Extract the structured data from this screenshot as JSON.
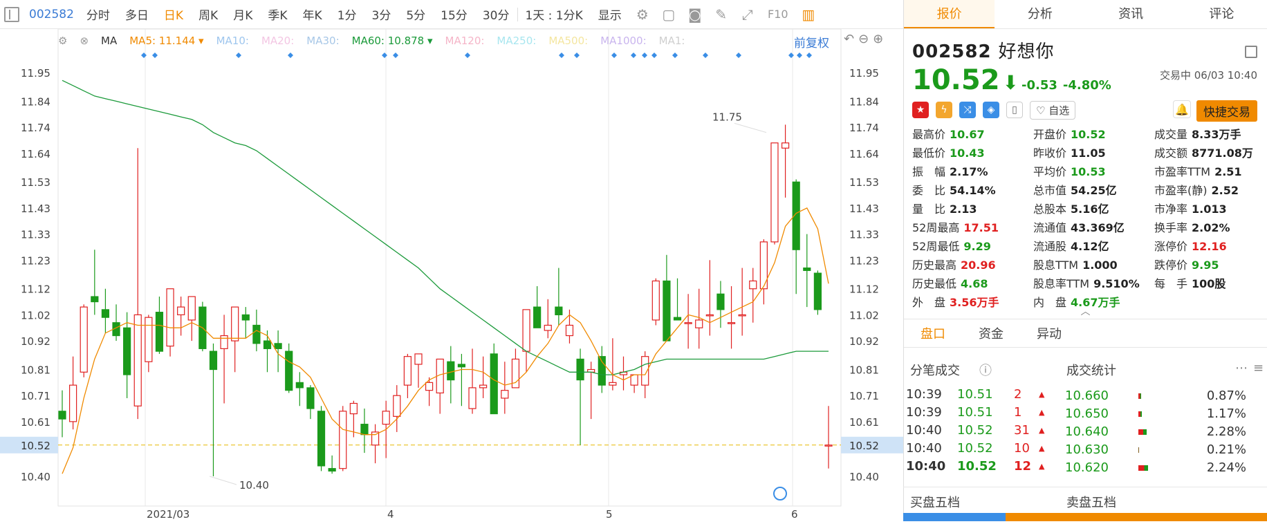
{
  "toolbar": {
    "code": "002582",
    "tabs": [
      "分时",
      "多日",
      "日K",
      "周K",
      "月K",
      "季K",
      "年K",
      "1分",
      "3分",
      "5分",
      "15分",
      "30分"
    ],
    "active_tab": "日K",
    "period_select": "1天 : 1分K",
    "display_label": "显示",
    "f10_label": "F10"
  },
  "ma_bar": {
    "ma_label": "MA",
    "items": [
      {
        "label": "MA5: 11.144",
        "color": "#f08a00",
        "active": true
      },
      {
        "label": "MA10:",
        "color": "#9ec6ee",
        "active": false
      },
      {
        "label": "MA20:",
        "color": "#f3c6e3",
        "active": false
      },
      {
        "label": "MA30:",
        "color": "#a7c7e7",
        "active": false
      },
      {
        "label": "MA60: 10.878",
        "color": "#1b9a3a",
        "active": true
      },
      {
        "label": "MA120:",
        "color": "#f5b5c8",
        "active": false
      },
      {
        "label": "MA250:",
        "color": "#a8e6ef",
        "active": false
      },
      {
        "label": "MA500:",
        "color": "#f4e6a0",
        "active": false
      },
      {
        "label": "MA1000:",
        "color": "#c9b5ee",
        "active": false
      },
      {
        "label": "MA1:",
        "color": "#cfcfcf",
        "active": false
      }
    ],
    "adjust_label": "前复权"
  },
  "chart_data": {
    "type": "candlestick",
    "y_ticks": [
      11.95,
      11.84,
      11.74,
      11.64,
      11.53,
      11.43,
      11.33,
      11.23,
      11.12,
      11.02,
      10.92,
      10.81,
      10.71,
      10.61,
      10.52,
      10.4
    ],
    "x_labels": [
      "2021/03",
      "4",
      "5",
      "6"
    ],
    "current_price_label": "10.52",
    "annotations": {
      "high": "11.75",
      "low": "10.40"
    },
    "up_color": "#e02020",
    "down_color": "#1b9a1b",
    "candles": [
      [
        10.65,
        10.73,
        10.55,
        10.62
      ],
      [
        10.61,
        10.86,
        10.58,
        10.75
      ],
      [
        10.8,
        11.06,
        10.78,
        11.05
      ],
      [
        11.09,
        11.27,
        11.02,
        11.07
      ],
      [
        11.04,
        11.12,
        10.95,
        11.01
      ],
      [
        10.99,
        11.06,
        10.92,
        10.94
      ],
      [
        10.97,
        11.03,
        10.7,
        10.79
      ],
      [
        10.67,
        11.66,
        10.62,
        11.02
      ],
      [
        10.84,
        11.02,
        10.8,
        11.01
      ],
      [
        11.03,
        11.09,
        10.87,
        10.88
      ],
      [
        10.9,
        11.12,
        10.86,
        11.12
      ],
      [
        11.02,
        11.09,
        10.94,
        11.05
      ],
      [
        11.0,
        11.09,
        10.92,
        11.09
      ],
      [
        11.05,
        11.07,
        10.88,
        10.89
      ],
      [
        10.88,
        10.91,
        10.4,
        10.81
      ],
      [
        10.89,
        11.02,
        10.68,
        10.94
      ],
      [
        10.92,
        11.05,
        10.8,
        11.05
      ],
      [
        11.02,
        11.05,
        10.93,
        11.0
      ],
      [
        10.98,
        11.04,
        10.88,
        10.91
      ],
      [
        10.92,
        10.96,
        10.8,
        10.89
      ],
      [
        10.91,
        10.96,
        10.8,
        10.89
      ],
      [
        10.88,
        10.91,
        10.72,
        10.73
      ],
      [
        10.76,
        10.8,
        10.67,
        10.74
      ],
      [
        10.74,
        10.75,
        10.62,
        10.66
      ],
      [
        10.65,
        10.67,
        10.42,
        10.44
      ],
      [
        10.43,
        10.48,
        10.41,
        10.42
      ],
      [
        10.43,
        10.67,
        10.42,
        10.65
      ],
      [
        10.64,
        10.69,
        10.55,
        10.68
      ],
      [
        10.6,
        10.66,
        10.49,
        10.56
      ],
      [
        10.52,
        10.6,
        10.45,
        10.57
      ],
      [
        10.6,
        10.69,
        10.47,
        10.65
      ],
      [
        10.63,
        10.75,
        10.57,
        10.71
      ],
      [
        10.75,
        10.87,
        10.7,
        10.86
      ],
      [
        10.83,
        10.87,
        10.74,
        10.87
      ],
      [
        10.73,
        10.78,
        10.67,
        10.76
      ],
      [
        10.72,
        10.85,
        10.64,
        10.85
      ],
      [
        10.84,
        10.9,
        10.68,
        10.77
      ],
      [
        10.83,
        10.87,
        10.67,
        10.82
      ],
      [
        10.66,
        10.89,
        10.64,
        10.74
      ],
      [
        10.74,
        10.86,
        10.7,
        10.75
      ],
      [
        10.87,
        10.91,
        10.66,
        10.64
      ],
      [
        10.7,
        10.84,
        10.64,
        10.73
      ],
      [
        10.74,
        10.89,
        10.74,
        10.85
      ],
      [
        10.88,
        11.04,
        10.8,
        11.04
      ],
      [
        11.05,
        11.13,
        10.97,
        10.97
      ],
      [
        10.96,
        11.08,
        10.93,
        10.98
      ],
      [
        11.05,
        11.2,
        10.98,
        11.02
      ],
      [
        10.94,
        11.04,
        10.91,
        10.98
      ],
      [
        10.85,
        10.89,
        10.52,
        10.77
      ],
      [
        10.8,
        10.84,
        10.62,
        10.81
      ],
      [
        10.86,
        10.9,
        10.72,
        10.75
      ],
      [
        10.75,
        10.93,
        10.73,
        10.76
      ],
      [
        10.79,
        10.86,
        10.73,
        10.8
      ],
      [
        10.75,
        10.79,
        10.72,
        10.79
      ],
      [
        10.75,
        10.88,
        10.7,
        10.86
      ],
      [
        11.0,
        11.16,
        10.98,
        11.15
      ],
      [
        11.15,
        11.25,
        10.98,
        10.92
      ],
      [
        11.01,
        11.16,
        11.0,
        11.0
      ],
      [
        10.99,
        11.1,
        10.89,
        10.99
      ],
      [
        10.97,
        11.12,
        10.89,
        11.0
      ],
      [
        11.02,
        11.23,
        10.94,
        11.02
      ],
      [
        11.1,
        11.15,
        10.97,
        11.04
      ],
      [
        10.99,
        11.13,
        10.89,
        10.99
      ],
      [
        11.02,
        11.2,
        10.94,
        11.02
      ],
      [
        11.12,
        11.2,
        10.99,
        11.15
      ],
      [
        11.12,
        11.31,
        11.06,
        11.3
      ],
      [
        11.3,
        11.68,
        11.29,
        11.68
      ],
      [
        11.66,
        11.75,
        11.47,
        11.68
      ],
      [
        11.53,
        11.54,
        11.1,
        11.27
      ],
      [
        11.2,
        11.33,
        11.05,
        11.19
      ],
      [
        11.18,
        11.19,
        11.02,
        11.04
      ],
      [
        10.52,
        10.67,
        10.43,
        10.52
      ]
    ],
    "ma5": [
      10.41,
      10.51,
      10.7,
      10.85,
      10.95,
      10.97,
      10.99,
      10.98,
      10.98,
      10.98,
      10.97,
      10.97,
      10.99,
      10.97,
      10.93,
      10.93,
      10.93,
      10.93,
      10.96,
      10.94,
      10.87,
      10.84,
      10.82,
      10.78,
      10.7,
      10.62,
      10.58,
      10.57,
      10.56,
      10.56,
      10.58,
      10.62,
      10.67,
      10.73,
      10.77,
      10.79,
      10.8,
      10.81,
      10.81,
      10.8,
      10.77,
      10.75,
      10.76,
      10.8,
      10.86,
      10.91,
      10.98,
      11.02,
      10.99,
      10.92,
      10.84,
      10.79,
      10.77,
      10.79,
      10.79,
      10.87,
      10.92,
      10.97,
      11.02,
      11.01,
      10.99,
      11.01,
      11.03,
      11.05,
      11.07,
      11.13,
      11.22,
      11.36,
      11.41,
      11.43,
      11.35,
      11.14
    ],
    "ma60": [
      11.92,
      11.9,
      11.88,
      11.86,
      11.85,
      11.84,
      11.83,
      11.82,
      11.81,
      11.8,
      11.79,
      11.78,
      11.77,
      11.75,
      11.72,
      11.7,
      11.68,
      11.67,
      11.65,
      11.62,
      11.59,
      11.56,
      11.53,
      11.5,
      11.47,
      11.44,
      11.41,
      11.38,
      11.35,
      11.32,
      11.29,
      11.26,
      11.23,
      11.2,
      11.16,
      11.12,
      11.09,
      11.06,
      11.03,
      11.0,
      10.97,
      10.94,
      10.91,
      10.88,
      10.86,
      10.84,
      10.82,
      10.8,
      10.8,
      10.8,
      10.79,
      10.79,
      10.8,
      10.81,
      10.83,
      10.84,
      10.85,
      10.85,
      10.85,
      10.85,
      10.85,
      10.85,
      10.85,
      10.85,
      10.85,
      10.85,
      10.86,
      10.87,
      10.88,
      10.88,
      10.88,
      10.88
    ]
  },
  "stock": {
    "code": "002582",
    "name": "好想你",
    "price": "10.52",
    "change": "-0.53",
    "change_pct": "-4.80%",
    "status": "交易中 06/03 10:40",
    "fav_label": "自选",
    "quick_trade_label": "快捷交易"
  },
  "quote": [
    {
      "label": "最高价",
      "value": "10.67",
      "color": "g"
    },
    {
      "label": "开盘价",
      "value": "10.52",
      "color": "g"
    },
    {
      "label": "成交量",
      "value": "8.33万手",
      "color": "k"
    },
    {
      "label": "最低价",
      "value": "10.43",
      "color": "g"
    },
    {
      "label": "昨收价",
      "value": "11.05",
      "color": "k"
    },
    {
      "label": "成交额",
      "value": "8771.08万",
      "color": "k"
    },
    {
      "label": "振　幅",
      "value": "2.17%",
      "color": "k"
    },
    {
      "label": "平均价",
      "value": "10.53",
      "color": "g"
    },
    {
      "label": "市盈率TTM",
      "value": "2.51",
      "color": "k"
    },
    {
      "label": "委　比",
      "value": "54.14%",
      "color": "k"
    },
    {
      "label": "总市值",
      "value": "54.25亿",
      "color": "k"
    },
    {
      "label": "市盈率(静)",
      "value": "2.52",
      "color": "k"
    },
    {
      "label": "量　比",
      "value": "2.13",
      "color": "k"
    },
    {
      "label": "总股本",
      "value": "5.16亿",
      "color": "k"
    },
    {
      "label": "市净率",
      "value": "1.013",
      "color": "k"
    },
    {
      "label": "52周最高",
      "value": "17.51",
      "color": "r"
    },
    {
      "label": "流通值",
      "value": "43.369亿",
      "color": "k"
    },
    {
      "label": "换手率",
      "value": "2.02%",
      "color": "k"
    },
    {
      "label": "52周最低",
      "value": "9.29",
      "color": "g"
    },
    {
      "label": "流通股",
      "value": "4.12亿",
      "color": "k"
    },
    {
      "label": "涨停价",
      "value": "12.16",
      "color": "r"
    },
    {
      "label": "历史最高",
      "value": "20.96",
      "color": "r"
    },
    {
      "label": "股息TTM",
      "value": "1.000",
      "color": "k"
    },
    {
      "label": "跌停价",
      "value": "9.95",
      "color": "g"
    },
    {
      "label": "历史最低",
      "value": "4.68",
      "color": "g"
    },
    {
      "label": "股息率TTM",
      "value": "9.510%",
      "color": "k"
    },
    {
      "label": "每　手",
      "value": "100股",
      "color": "k"
    },
    {
      "label": "外　盘",
      "value": "3.56万手",
      "color": "r"
    },
    {
      "label": "内　盘",
      "value": "4.67万手",
      "color": "g"
    }
  ],
  "subtabs": [
    "盘口",
    "资金",
    "异动"
  ],
  "ticks": {
    "title": "分笔成交",
    "rows": [
      {
        "time": "10:39",
        "price": "10.51",
        "vol": "2"
      },
      {
        "time": "10:39",
        "price": "10.51",
        "vol": "1"
      },
      {
        "time": "10:40",
        "price": "10.52",
        "vol": "31"
      },
      {
        "time": "10:40",
        "price": "10.52",
        "vol": "10"
      },
      {
        "time": "10:40",
        "price": "10.52",
        "vol": "12"
      }
    ]
  },
  "stats": {
    "title": "成交统计",
    "rows": [
      {
        "price": "10.660",
        "pct": "0.87%"
      },
      {
        "price": "10.650",
        "pct": "1.17%"
      },
      {
        "price": "10.640",
        "pct": "2.28%"
      },
      {
        "price": "10.630",
        "pct": "0.21%"
      },
      {
        "price": "10.620",
        "pct": "2.24%"
      }
    ]
  },
  "bottom": {
    "buy_label": "买盘五档",
    "sell_label": "卖盘五档"
  }
}
